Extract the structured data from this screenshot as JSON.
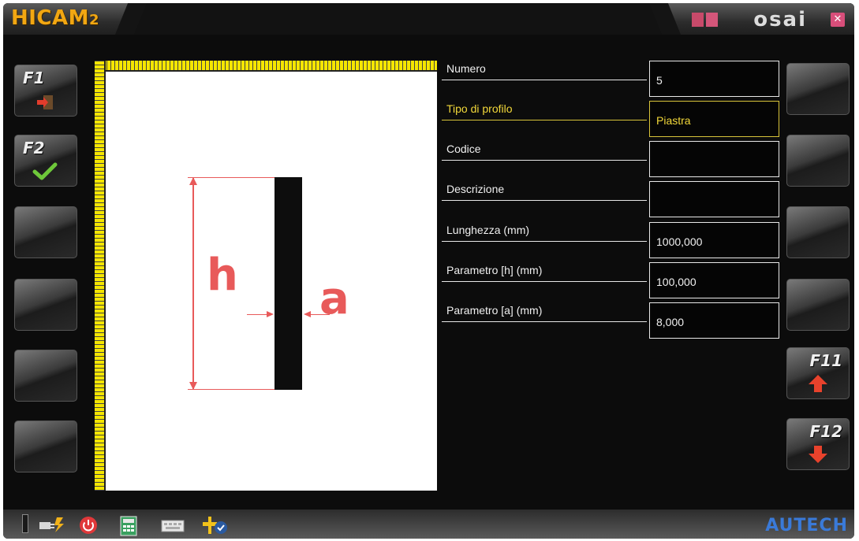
{
  "window": {
    "title_main": "HICAM",
    "title_sub": "2",
    "brand": "osai",
    "brand_icon": "ks-logo-icon",
    "close_icon": "close-icon",
    "close_glyph": "✕"
  },
  "left_buttons": [
    {
      "key": "F1",
      "icon": "exit-door-icon"
    },
    {
      "key": "F2",
      "icon": "checkmark-icon"
    },
    {
      "key": "",
      "icon": ""
    },
    {
      "key": "",
      "icon": ""
    },
    {
      "key": "",
      "icon": ""
    },
    {
      "key": "",
      "icon": ""
    }
  ],
  "right_buttons": [
    {
      "key": "",
      "icon": ""
    },
    {
      "key": "",
      "icon": ""
    },
    {
      "key": "",
      "icon": ""
    },
    {
      "key": "",
      "icon": ""
    },
    {
      "key": "F11",
      "icon": "arrow-up-icon"
    },
    {
      "key": "F12",
      "icon": "arrow-down-icon"
    }
  ],
  "drawing": {
    "label_h": "h",
    "label_a": "a",
    "accent_color": "#e85a5a"
  },
  "form": {
    "fields": [
      {
        "label": "Numero",
        "value": "5",
        "active": false
      },
      {
        "label": "Tipo di profilo",
        "value": "Piastra",
        "active": true
      },
      {
        "label": "Codice",
        "value": "",
        "active": false
      },
      {
        "label": "Descrizione",
        "value": "",
        "active": false
      },
      {
        "label": "Lunghezza (mm)",
        "value": "1000,000",
        "active": false
      },
      {
        "label": "Parametro [h] (mm)",
        "value": "100,000",
        "active": false
      },
      {
        "label": "Parametro [a] (mm)",
        "value": "8,000",
        "active": false
      }
    ]
  },
  "statusbar": {
    "icons": [
      "power-plug-icon",
      "power-icon",
      "calculator-icon",
      "keyboard-icon",
      "tool-settings-icon"
    ],
    "brand": "AUTECH"
  },
  "colors": {
    "title": "#f2a712",
    "active_field": "#f2d83a",
    "ruler": "#f5e600",
    "autech": "#3a7ad8"
  }
}
